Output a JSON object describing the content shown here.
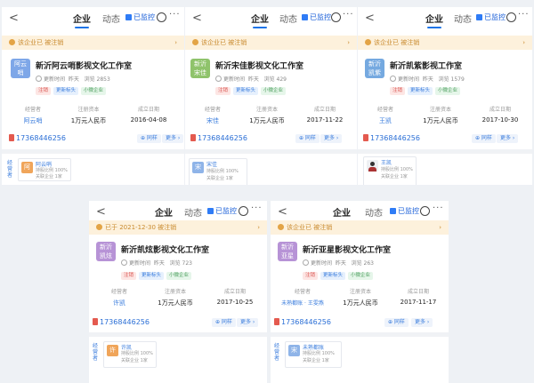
{
  "cards": [
    {
      "tabs": {
        "back": "<",
        "company": "企业",
        "dynamic": "动态",
        "watch": "已监控",
        "more": "···"
      },
      "notice": "该企业已 被注销",
      "logo_text": "阿云 哨",
      "name": "新沂阿云哨影视文化工作室",
      "meta_label": "更新时间",
      "meta_date": "昨天",
      "meta_visits_label": "浏览",
      "meta_visits": "2853",
      "tags": [
        "注销",
        "更新标头",
        "小微企业"
      ],
      "info": [
        {
          "label": "经营者",
          "value": "阿云哨",
          "link": true
        },
        {
          "label": "注册资本",
          "value": "1万元人民币"
        },
        {
          "label": "成立日期",
          "value": "2016-04-08"
        }
      ],
      "phone": "17368446256",
      "btn1": "⊕ 同样",
      "btn2": "更多 ›",
      "person": {
        "tag": "经营者",
        "avatar": "阿",
        "name": "阿云哨",
        "line1": "持股比例 100%",
        "line2": "关联企业 1家"
      }
    },
    {
      "tabs": {
        "back": "<",
        "company": "企业",
        "dynamic": "动态",
        "watch": "已监控",
        "more": "···"
      },
      "notice": "该企业已 被注销",
      "logo_text": "新沂 宋佳",
      "name": "新沂宋佳影视文化工作室",
      "meta_label": "更新时间",
      "meta_date": "昨天",
      "meta_visits_label": "浏览",
      "meta_visits": "429",
      "tags": [
        "注销",
        "更新标头",
        "小微企业"
      ],
      "info": [
        {
          "label": "经营者",
          "value": "宋佳",
          "link": true
        },
        {
          "label": "注册资本",
          "value": "1万元人民币"
        },
        {
          "label": "成立日期",
          "value": "2017-11-22"
        }
      ],
      "phone": "17368446256",
      "btn1": "⊕ 同样",
      "btn2": "更多 ›",
      "person": {
        "tag": "经营者",
        "avatar": "宋",
        "name": "宋佳",
        "line1": "持股比例 100%",
        "line2": "关联企业 1家"
      }
    },
    {
      "tabs": {
        "back": "<",
        "company": "企业",
        "dynamic": "动态",
        "watch": "已监控",
        "more": "···"
      },
      "notice": "该企业已 被注销",
      "logo_text": "新沂 凯紫",
      "name": "新沂凯紫影视工作室",
      "meta_label": "更新时间",
      "meta_date": "昨天",
      "meta_visits_label": "浏览",
      "meta_visits": "1579",
      "tags": [
        "注销",
        "更新标头",
        "小微企业"
      ],
      "info": [
        {
          "label": "经营者",
          "value": "王凯",
          "link": true
        },
        {
          "label": "注册资本",
          "value": "1万元人民币"
        },
        {
          "label": "成立日期",
          "value": "2017-10-30"
        }
      ],
      "phone": "17368446256",
      "btn1": "⊕ 同样",
      "btn2": "更多 ›",
      "person": {
        "tag": "",
        "avatar": "",
        "name": "王凯",
        "line1": "持股比例 100%",
        "line2": "关联企业 1家"
      }
    },
    {
      "tabs": {
        "back": "<",
        "company": "企业",
        "dynamic": "动态",
        "watch": "已监控",
        "more": "···"
      },
      "notice": "已于 2021-12-30 被注销",
      "logo_text": "新沂 凯炫",
      "name": "新沂凯炫影视文化工作室",
      "meta_label": "更新时间",
      "meta_date": "昨天",
      "meta_visits_label": "浏览",
      "meta_visits": "723",
      "tags": [
        "注销",
        "更新标头",
        "小微企业"
      ],
      "info": [
        {
          "label": "经营者",
          "value": "许凯",
          "link": true
        },
        {
          "label": "注册资本",
          "value": "1万元人民币"
        },
        {
          "label": "成立日期",
          "value": "2017-10-25"
        }
      ],
      "phone": "17368446256",
      "btn1": "⊕ 同样",
      "btn2": "更多 ›",
      "person": {
        "tag": "经营者",
        "avatar": "许",
        "name": "许凯",
        "line1": "持股比例 100%",
        "line2": "关联企业 1家"
      }
    },
    {
      "tabs": {
        "back": "<",
        "company": "企业",
        "dynamic": "动态",
        "watch": "已监控",
        "more": "···"
      },
      "notice": "该企业已 被注销",
      "logo_text": "新沂 亚星",
      "name": "新沂亚星影视文化工作室",
      "meta_label": "更新时间",
      "meta_date": "昨天",
      "meta_visits_label": "浏览",
      "meta_visits": "263",
      "tags": [
        "注销",
        "更新标头",
        "小微企业"
      ],
      "info": [
        {
          "label": "经营者",
          "value": "未熟都账 · 王雯燕",
          "link": true
        },
        {
          "label": "注册资本",
          "value": "1万元人民币"
        },
        {
          "label": "成立日期",
          "value": "2017-11-17"
        }
      ],
      "phone": "17368446256",
      "btn1": "⊕ 同样",
      "btn2": "更多 ›",
      "person": {
        "tag": "经营者",
        "avatar": "宋",
        "name": "未熟都账",
        "line1": "持股比例 100%",
        "line2": "关联企业 1家"
      }
    }
  ]
}
